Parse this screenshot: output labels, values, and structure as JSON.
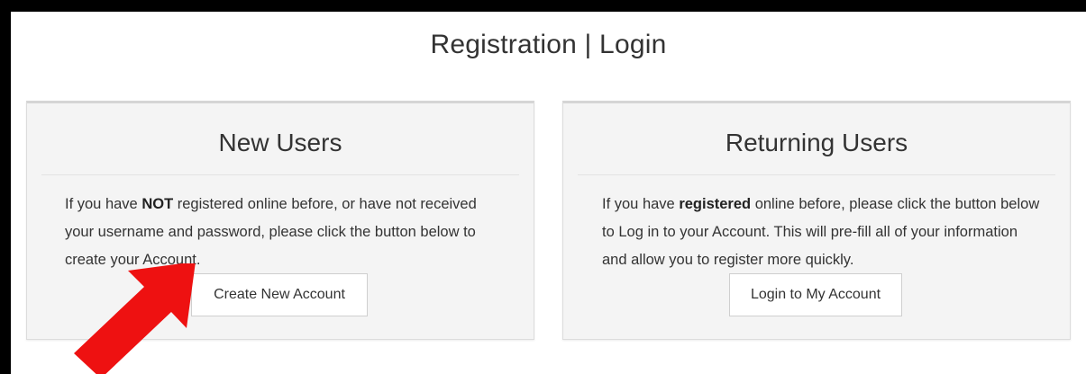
{
  "page": {
    "title": "Registration | Login"
  },
  "new_users": {
    "heading": "New Users",
    "text_before": "If you have ",
    "text_bold": "NOT",
    "text_after": " registered online before, or have not received your username and password, please click the button below to create your Account.",
    "button_label": "Create New Account"
  },
  "returning_users": {
    "heading": "Returning Users",
    "text_before": "If you have ",
    "text_bold": "registered",
    "text_after": " online before, please click the button below to Log in to your Account. This will pre-fill all of your information and allow you to register more quickly.",
    "button_label": "Login to My Account"
  },
  "colors": {
    "arrow": "#ee1111",
    "panel_bg": "#f4f4f4",
    "frame_border": "#000000"
  },
  "icons": {
    "annotation_arrow": "red-arrow-icon"
  }
}
